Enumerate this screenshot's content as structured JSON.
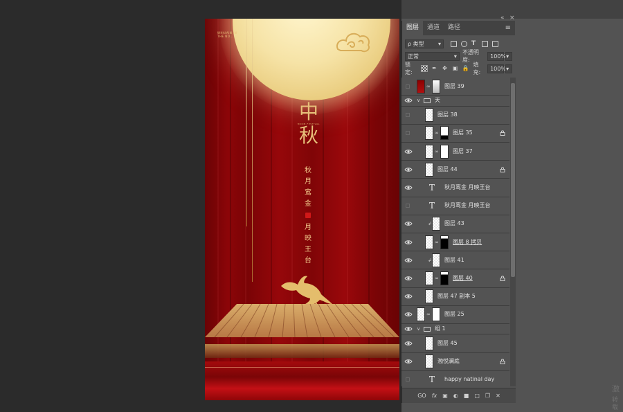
{
  "app": {
    "collapse_label": "«",
    "close_label": "×"
  },
  "poster": {
    "tiny_text": "WHAIAIN IN\nTHE NO...",
    "title": "中秋",
    "title_sub": "MOON  FESTIVAL",
    "col1": [
      "秋",
      "月",
      "鸾",
      "金"
    ],
    "col2": [
      "月",
      "映",
      "王",
      "台"
    ]
  },
  "panel": {
    "tabs": [
      {
        "label": "图层"
      },
      {
        "label": "通道"
      },
      {
        "label": "路径"
      }
    ],
    "menu_glyph": "≡",
    "filter_label": "ρ 类型",
    "blend_mode": "正常",
    "opacity_label": "不透明度:",
    "opacity_value": "100%",
    "lock_label": "锁定:",
    "fill_label": "填充:",
    "fill_value": "100%",
    "layers": [
      {
        "name": "图层 39",
        "type": "layer",
        "visible": false
      },
      {
        "name": "天",
        "type": "folder",
        "visible": true
      },
      {
        "name": "图层 38",
        "type": "layer",
        "visible": false
      },
      {
        "name": "图层 35",
        "type": "layer",
        "visible": false
      },
      {
        "name": "图层 37",
        "type": "layer",
        "visible": true
      },
      {
        "name": "图层 44",
        "type": "layer",
        "visible": true
      },
      {
        "name": "秋月鸾金   月映王台",
        "type": "text",
        "visible": true
      },
      {
        "name": "秋月鸾金   月映王台",
        "type": "text",
        "visible": false
      },
      {
        "name": "图层 43",
        "type": "layer",
        "visible": true
      },
      {
        "name": "图层 8 拷贝",
        "type": "layer",
        "visible": true
      },
      {
        "name": "图层 41",
        "type": "layer",
        "visible": true
      },
      {
        "name": "图层 40",
        "type": "layer",
        "visible": true
      },
      {
        "name": "图层 47 副本 5",
        "type": "layer",
        "visible": true
      },
      {
        "name": "图层 25",
        "type": "layer",
        "visible": true
      },
      {
        "name": "组 1",
        "type": "folder",
        "visible": true
      },
      {
        "name": "图层 45",
        "type": "layer",
        "visible": true
      },
      {
        "name": "渤悦澜庭",
        "type": "layer",
        "visible": true
      },
      {
        "name": "happy natinal day",
        "type": "text",
        "visible": false
      }
    ],
    "bottom_icons": [
      "GO",
      "fx",
      "▣",
      "◐",
      "■",
      "□",
      "❐",
      "✕"
    ]
  },
  "watermark": {
    "line1": "激",
    "line2": "转载"
  }
}
